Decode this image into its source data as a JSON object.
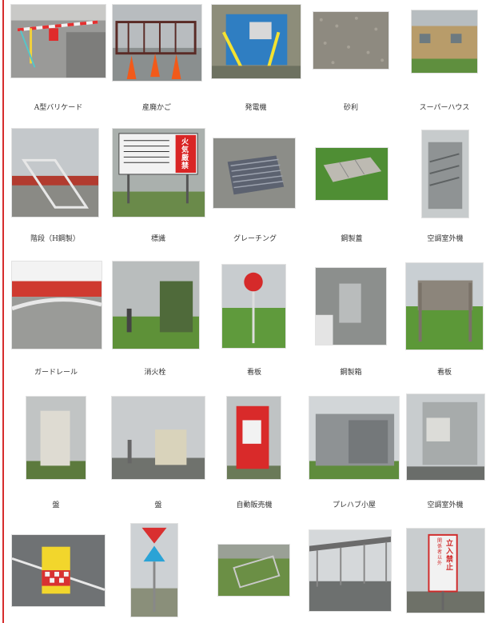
{
  "page": {
    "rows": [
      [
        "A型バリケード",
        "産廃かご",
        "発電機",
        "砂利",
        "スーパーハウス"
      ],
      [
        "階段（H鋼製）",
        "標識",
        "グレーチング",
        "鋼製蓋",
        "空調室外機"
      ],
      [
        "ガードレール",
        "消火栓",
        "看板",
        "鋼製箱",
        "看板"
      ],
      [
        "盤",
        "盤",
        "自動販売機",
        "プレハブ小屋",
        "空調室外機"
      ],
      [
        "",
        "",
        "",
        "",
        ""
      ]
    ],
    "sign_text": {
      "fire_sign": "火気厳禁",
      "no_entry_line1": "関係者以外",
      "no_entry_line2": "立入禁止"
    }
  }
}
